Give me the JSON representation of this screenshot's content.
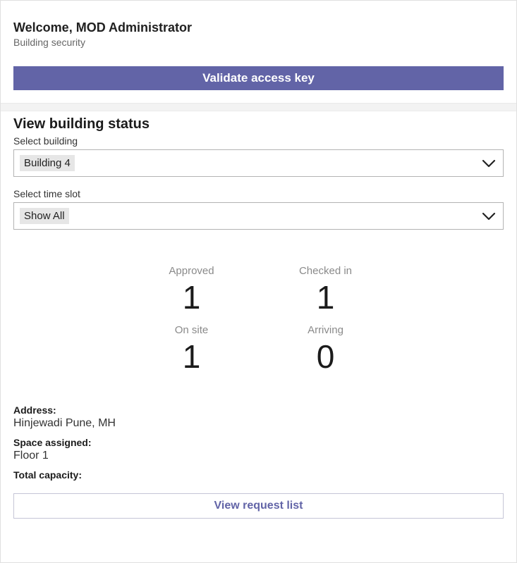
{
  "header": {
    "welcome": "Welcome, MOD Administrator",
    "subtitle": "Building security",
    "validate_button": "Validate access key"
  },
  "status": {
    "title": "View building status",
    "building_label": "Select building",
    "building_value": "Building 4",
    "timeslot_label": "Select time slot",
    "timeslot_value": "Show All"
  },
  "stats": {
    "approved_label": "Approved",
    "approved_value": "1",
    "checkedin_label": "Checked in",
    "checkedin_value": "1",
    "onsite_label": "On site",
    "onsite_value": "1",
    "arriving_label": "Arriving",
    "arriving_value": "0"
  },
  "details": {
    "address_label": "Address:",
    "address_value": "Hinjewadi Pune, MH",
    "space_label": "Space assigned:",
    "space_value": "Floor 1",
    "capacity_label": "Total capacity:"
  },
  "footer": {
    "view_request": "View request list"
  }
}
